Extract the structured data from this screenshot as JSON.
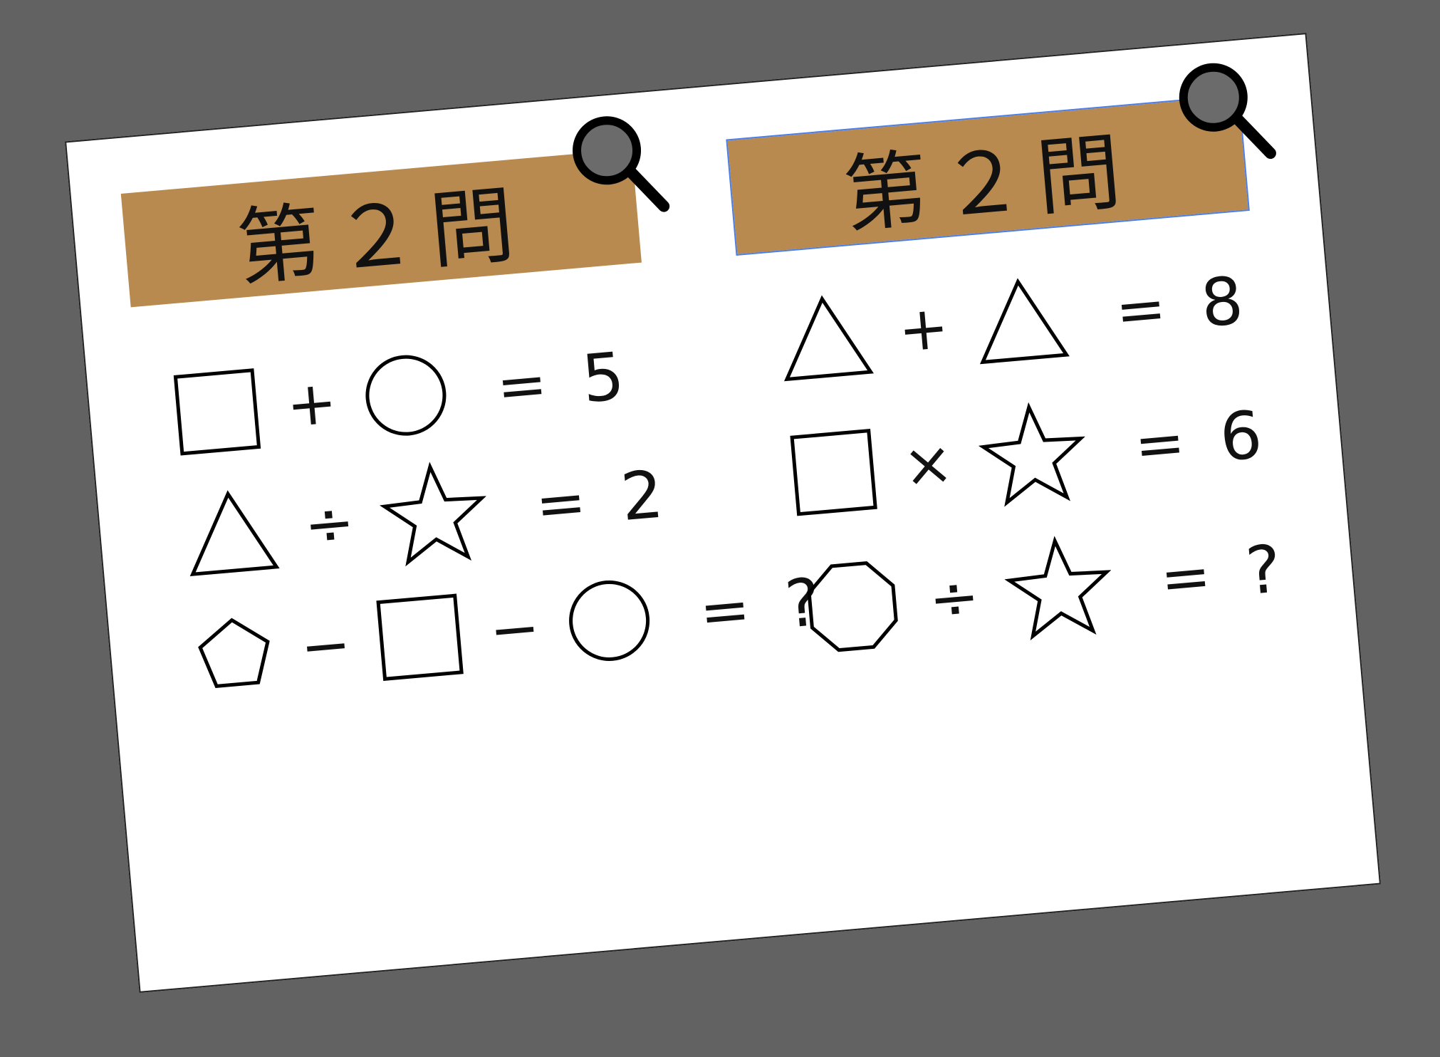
{
  "panels": [
    {
      "label": "第２問",
      "rows": [
        {
          "items": [
            "square",
            "+",
            "circle"
          ],
          "equals": "=",
          "result": "5"
        },
        {
          "items": [
            "triangle",
            "÷",
            "star"
          ],
          "equals": "=",
          "result": "2"
        },
        {
          "items": [
            "pentagon",
            "−",
            "square",
            "−",
            "circle"
          ],
          "equals": "=",
          "result": "?"
        }
      ]
    },
    {
      "label": "第２問",
      "rows": [
        {
          "items": [
            "triangle",
            "+",
            "triangle"
          ],
          "equals": "=",
          "result": "8"
        },
        {
          "items": [
            "square",
            "×",
            "star"
          ],
          "equals": "=",
          "result": "6"
        },
        {
          "items": [
            "octagon",
            "÷",
            "star"
          ],
          "equals": "=",
          "result": "?"
        }
      ]
    }
  ],
  "colors": {
    "label_band": "#b88a4f",
    "background": "#626262",
    "paper": "#ffffff",
    "magnifier_lens": "#6b6b6b",
    "selection": "#4a7ee8"
  },
  "icons": [
    "magnifier-icon",
    "square-icon",
    "circle-icon",
    "triangle-icon",
    "star-icon",
    "pentagon-icon",
    "octagon-icon"
  ]
}
